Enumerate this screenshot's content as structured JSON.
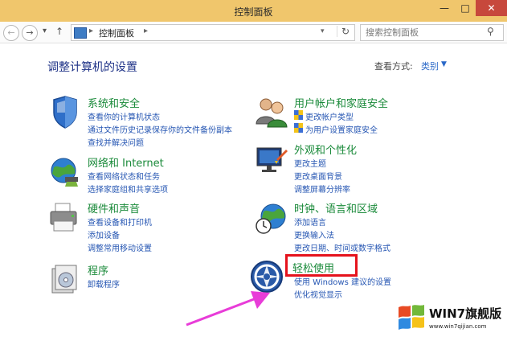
{
  "window": {
    "title": "控制面板",
    "minimize": "—",
    "maximize": "□",
    "close": "✕"
  },
  "address": {
    "back": "←",
    "forward": "→",
    "history": "▾",
    "up": "↑",
    "breadcrumb": "控制面板",
    "sep": "▸",
    "dropdown": "▾",
    "refresh": "↻"
  },
  "search": {
    "placeholder": "搜索控制面板",
    "icon": "⚲"
  },
  "header": {
    "title": "调整计算机的设置",
    "view_by_label": "查看方式:",
    "view_by_value": "类别",
    "caret": "▼"
  },
  "categories": {
    "system_security": {
      "heading": "系统和安全",
      "links": [
        "查看你的计算机状态",
        "通过文件历史记录保存你的文件备份副本",
        "查找并解决问题"
      ]
    },
    "user_accounts": {
      "heading": "用户帐户和家庭安全",
      "links": [
        "更改帐户类型",
        "为用户设置家庭安全"
      ]
    },
    "network": {
      "heading": "网络和 Internet",
      "links": [
        "查看网络状态和任务",
        "选择家庭组和共享选项"
      ]
    },
    "appearance": {
      "heading": "外观和个性化",
      "links": [
        "更改主题",
        "更改桌面背景",
        "调整屏幕分辨率"
      ]
    },
    "hardware": {
      "heading": "硬件和声音",
      "links": [
        "查看设备和打印机",
        "添加设备",
        "调整常用移动设置"
      ]
    },
    "clock": {
      "heading": "时钟、语言和区域",
      "links": [
        "添加语言",
        "更换输入法",
        "更改日期、时间或数字格式"
      ]
    },
    "programs": {
      "heading": "程序",
      "links": [
        "卸载程序"
      ]
    },
    "ease": {
      "heading": "轻松使用",
      "links": [
        "使用 Windows 建议的设置",
        "优化视觉显示"
      ]
    }
  },
  "watermark": {
    "text": "WIN7旗舰版",
    "url": "www.win7qijian.com"
  },
  "colors": {
    "title_bar": "#f0c66c",
    "heading_green": "#1a8a3a",
    "link_blue": "#2757b3",
    "highlight_red": "#e5121c",
    "arrow_magenta": "#e83cd8"
  }
}
